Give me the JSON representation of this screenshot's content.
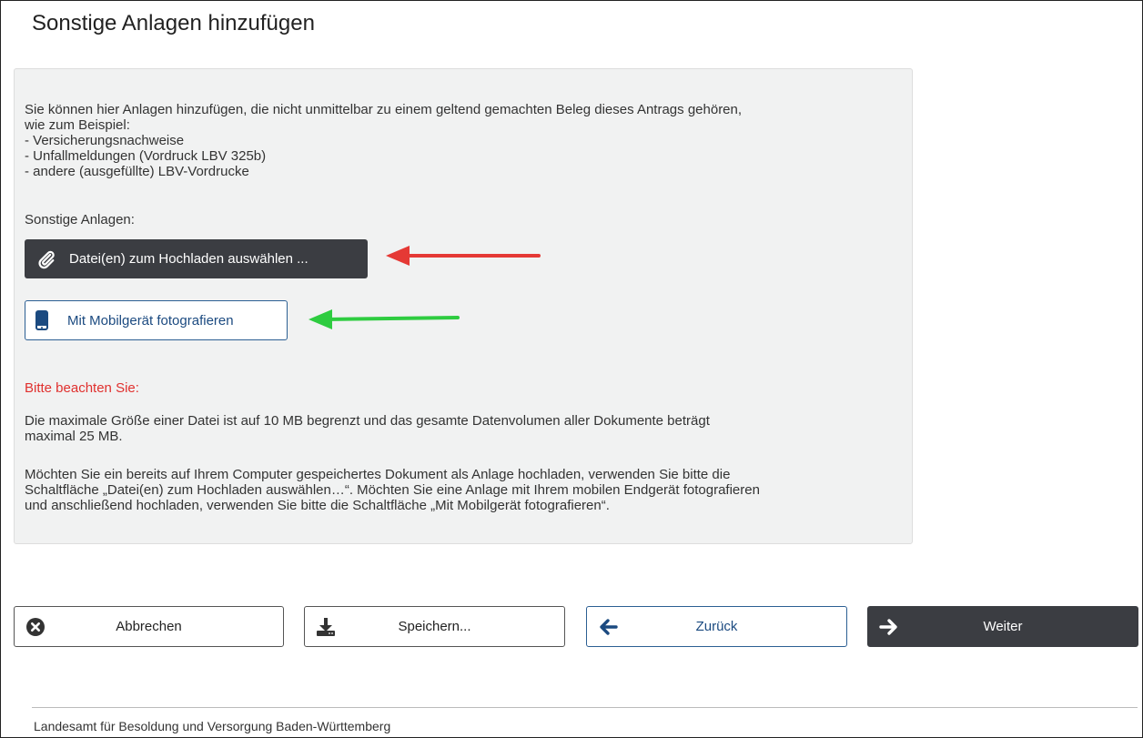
{
  "page": {
    "title": "Sonstige Anlagen hinzufügen"
  },
  "panel": {
    "intro_lines": [
      "Sie können hier Anlagen hinzufügen, die nicht unmittelbar zu einem geltend gemachten Beleg dieses Antrags gehören,",
      "wie zum Beispiel:",
      "- Versicherungsnachweise",
      "- Unfallmeldungen (Vordruck LBV 325b)",
      "- andere (ausgefüllte) LBV-Vordrucke"
    ],
    "section_label": "Sonstige Anlagen:",
    "upload_button": "Datei(en) zum Hochladen auswählen ...",
    "mobile_button": "Mit Mobilgerät fotografieren",
    "note_title": "Bitte beachten Sie:",
    "note1_lines": [
      "Die maximale Größe einer Datei ist auf 10 MB begrenzt und das gesamte Datenvolumen aller Dokumente beträgt",
      "maximal 25 MB."
    ],
    "note2_lines": [
      "Möchten Sie ein bereits auf Ihrem Computer gespeichertes Dokument als Anlage hochladen, verwenden Sie bitte die",
      "Schaltfläche „Datei(en) zum Hochladen auswählen…“. Möchten Sie eine Anlage mit Ihrem mobilen Endgerät fotografieren",
      "und anschließend hochladen, verwenden Sie bitte die Schaltfläche „Mit Mobilgerät fotografieren“."
    ]
  },
  "footer_buttons": {
    "cancel": "Abbrechen",
    "save": "Speichern...",
    "back": "Zurück",
    "next": "Weiter"
  },
  "footer": {
    "text": "Landesamt für Besoldung und Versorgung Baden-Württemberg"
  },
  "colors": {
    "dark_button": "#3b3d42",
    "blue_accent": "#1b4a80",
    "warning_red": "#e0302e",
    "annotation_red_arrow": "#e53935",
    "annotation_green_arrow": "#2ecc40"
  }
}
